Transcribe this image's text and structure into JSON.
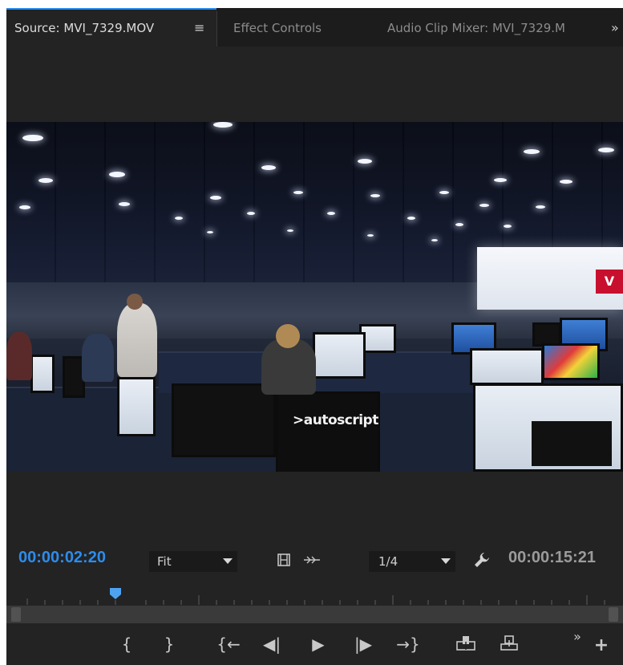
{
  "tabs": {
    "source": "Source: MVI_7329.MOV",
    "effect_controls": "Effect Controls",
    "audio_mixer": "Audio Clip Mixer: MVI_7329.M",
    "overflow": "»"
  },
  "viewer": {
    "frame_logo_text": ">autoscript"
  },
  "timecode": {
    "current": "00:00:02:20",
    "duration": "00:00:15:21"
  },
  "zoom": {
    "selected": "Fit"
  },
  "resolution": {
    "selected": "1/4"
  },
  "icons": {
    "tab_menu": "panel-menu-icon",
    "safe_margins": "film-strip-icon",
    "settings": "wrench-icon",
    "mark_in": "mark-in-icon",
    "mark_out": "mark-out-icon",
    "go_to_in": "go-to-in-icon",
    "step_back": "step-back-icon",
    "play": "play-icon",
    "step_forward": "step-forward-icon",
    "go_to_out": "go-to-out-icon",
    "insert": "insert-icon",
    "overwrite": "overwrite-icon",
    "more_controls": "more-controls-icon",
    "add_button": "add-icon"
  },
  "playhead": {
    "position_fraction": 0.177
  },
  "colors": {
    "accent": "#2d8ceb",
    "panel_bg": "#232323"
  }
}
